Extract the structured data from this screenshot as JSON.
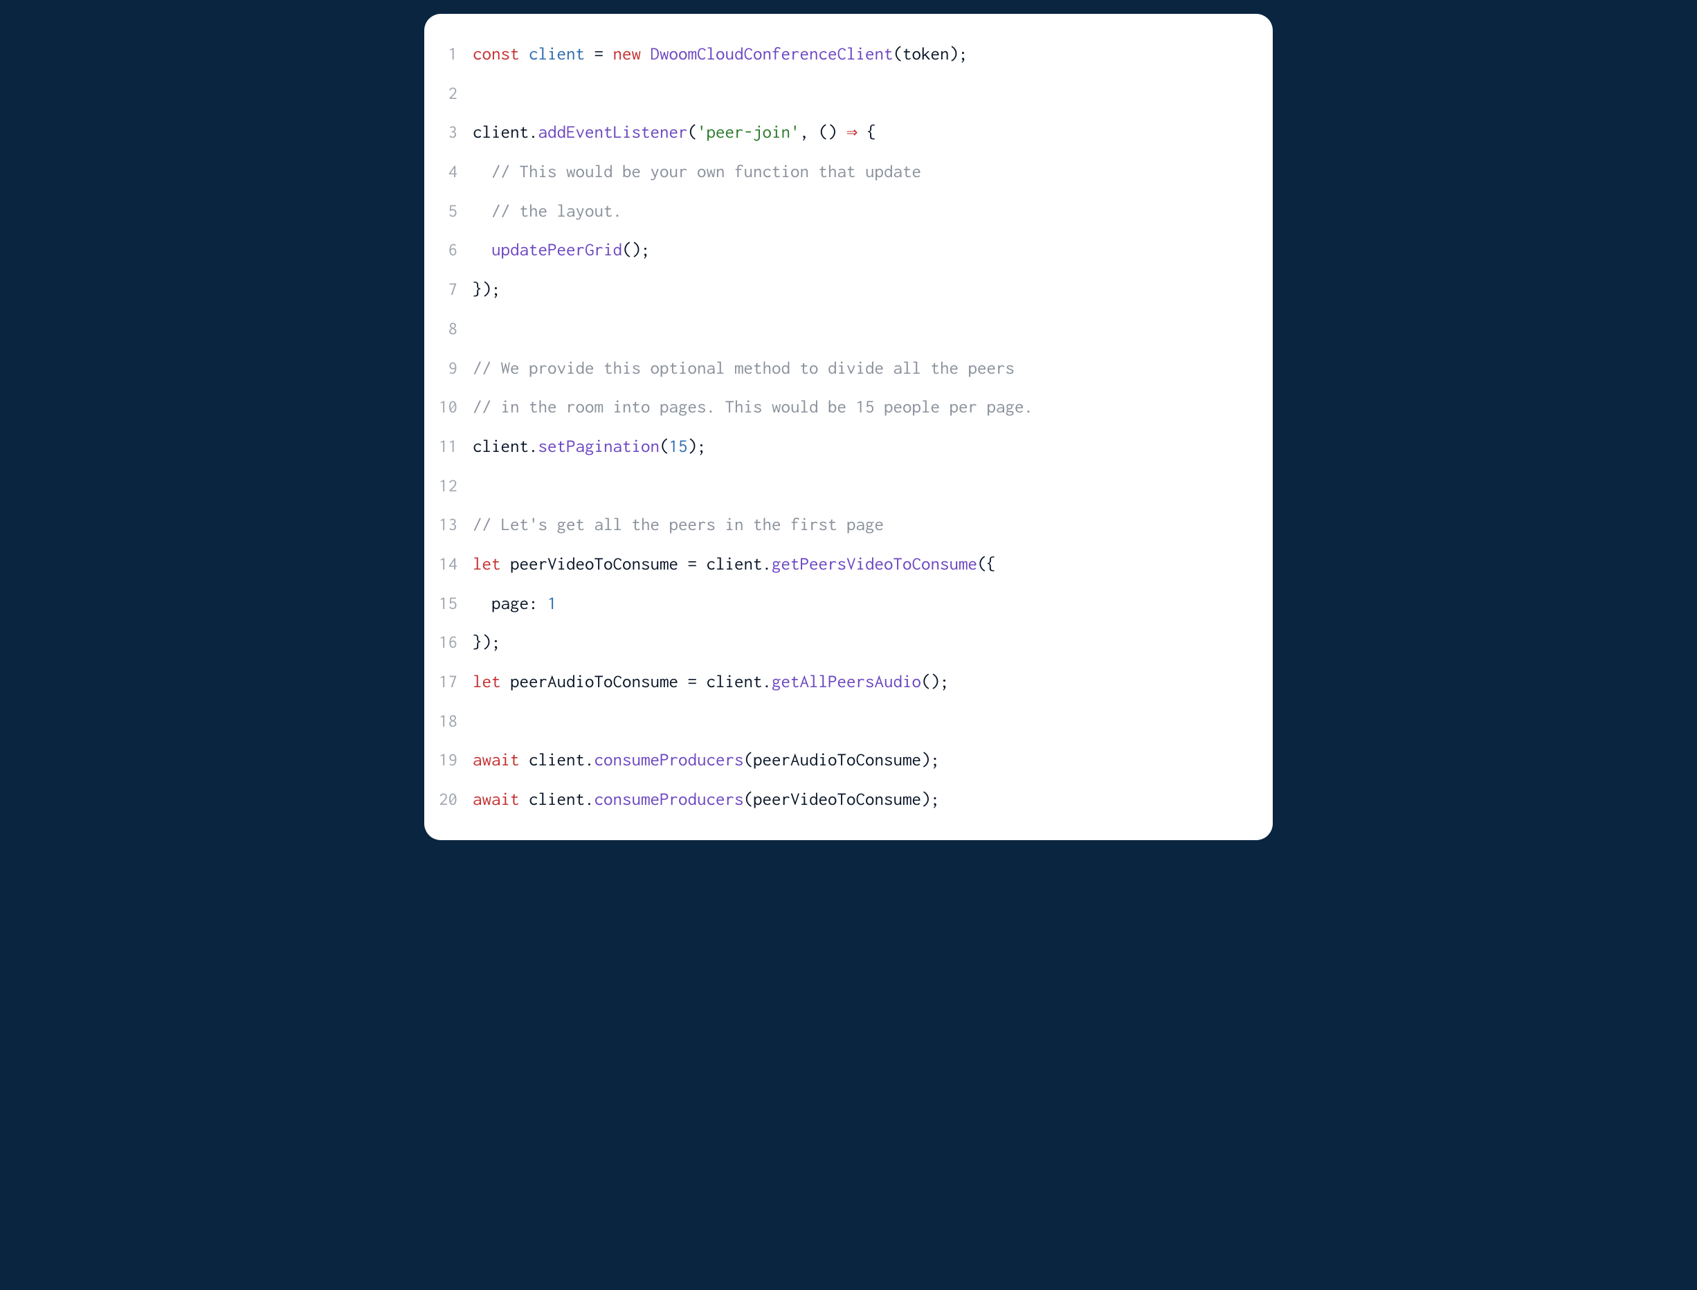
{
  "code": {
    "lines": [
      {
        "num": "1",
        "tokens": [
          {
            "t": "const ",
            "c": "tk-declare"
          },
          {
            "t": "client",
            "c": "tk-var"
          },
          {
            "t": " = ",
            "c": "tk-punct"
          },
          {
            "t": "new ",
            "c": "tk-keyword"
          },
          {
            "t": "DwoomCloudConferenceClient",
            "c": "tk-class"
          },
          {
            "t": "(token);",
            "c": "tk-punct"
          }
        ]
      },
      {
        "num": "2",
        "tokens": [
          {
            "t": "",
            "c": "tk-plain"
          }
        ]
      },
      {
        "num": "3",
        "tokens": [
          {
            "t": "client.",
            "c": "tk-plain"
          },
          {
            "t": "addEventListener",
            "c": "tk-method"
          },
          {
            "t": "(",
            "c": "tk-punct"
          },
          {
            "t": "'peer-join'",
            "c": "tk-string"
          },
          {
            "t": ", () ",
            "c": "tk-punct"
          },
          {
            "t": "⇒",
            "c": "tk-arrow"
          },
          {
            "t": " {",
            "c": "tk-punct"
          }
        ]
      },
      {
        "num": "4",
        "tokens": [
          {
            "t": "  ",
            "c": "tk-plain"
          },
          {
            "t": "// This would be your own function that update",
            "c": "tk-comment"
          }
        ]
      },
      {
        "num": "5",
        "tokens": [
          {
            "t": "  ",
            "c": "tk-plain"
          },
          {
            "t": "// the layout.",
            "c": "tk-comment"
          }
        ]
      },
      {
        "num": "6",
        "tokens": [
          {
            "t": "  ",
            "c": "tk-plain"
          },
          {
            "t": "updatePeerGrid",
            "c": "tk-method"
          },
          {
            "t": "();",
            "c": "tk-punct"
          }
        ]
      },
      {
        "num": "7",
        "tokens": [
          {
            "t": "});",
            "c": "tk-punct"
          }
        ]
      },
      {
        "num": "8",
        "tokens": [
          {
            "t": "",
            "c": "tk-plain"
          }
        ]
      },
      {
        "num": "9",
        "tokens": [
          {
            "t": "// We provide this optional method to divide all the peers",
            "c": "tk-comment"
          }
        ]
      },
      {
        "num": "10",
        "tokens": [
          {
            "t": "// in the room into pages. This would be 15 people per page.",
            "c": "tk-comment"
          }
        ]
      },
      {
        "num": "11",
        "tokens": [
          {
            "t": "client.",
            "c": "tk-plain"
          },
          {
            "t": "setPagination",
            "c": "tk-method"
          },
          {
            "t": "(",
            "c": "tk-punct"
          },
          {
            "t": "15",
            "c": "tk-number"
          },
          {
            "t": ");",
            "c": "tk-punct"
          }
        ]
      },
      {
        "num": "12",
        "tokens": [
          {
            "t": "",
            "c": "tk-plain"
          }
        ]
      },
      {
        "num": "13",
        "tokens": [
          {
            "t": "// Let's get all the peers in the first page",
            "c": "tk-comment"
          }
        ]
      },
      {
        "num": "14",
        "tokens": [
          {
            "t": "let ",
            "c": "tk-declare"
          },
          {
            "t": "peerVideoToConsume = client.",
            "c": "tk-plain"
          },
          {
            "t": "getPeersVideoToConsume",
            "c": "tk-method"
          },
          {
            "t": "({",
            "c": "tk-punct"
          }
        ]
      },
      {
        "num": "15",
        "tokens": [
          {
            "t": "  page: ",
            "c": "tk-plain"
          },
          {
            "t": "1",
            "c": "tk-number"
          }
        ]
      },
      {
        "num": "16",
        "tokens": [
          {
            "t": "});",
            "c": "tk-punct"
          }
        ]
      },
      {
        "num": "17",
        "tokens": [
          {
            "t": "let ",
            "c": "tk-declare"
          },
          {
            "t": "peerAudioToConsume = client.",
            "c": "tk-plain"
          },
          {
            "t": "getAllPeersAudio",
            "c": "tk-method"
          },
          {
            "t": "();",
            "c": "tk-punct"
          }
        ]
      },
      {
        "num": "18",
        "tokens": [
          {
            "t": "",
            "c": "tk-plain"
          }
        ]
      },
      {
        "num": "19",
        "tokens": [
          {
            "t": "await ",
            "c": "tk-keyword"
          },
          {
            "t": "client.",
            "c": "tk-plain"
          },
          {
            "t": "consumeProducers",
            "c": "tk-method"
          },
          {
            "t": "(peerAudioToConsume);",
            "c": "tk-punct"
          }
        ]
      },
      {
        "num": "20",
        "tokens": [
          {
            "t": "await ",
            "c": "tk-keyword"
          },
          {
            "t": "client.",
            "c": "tk-plain"
          },
          {
            "t": "consumeProducers",
            "c": "tk-method"
          },
          {
            "t": "(peerVideoToConsume);",
            "c": "tk-punct"
          }
        ]
      }
    ]
  }
}
